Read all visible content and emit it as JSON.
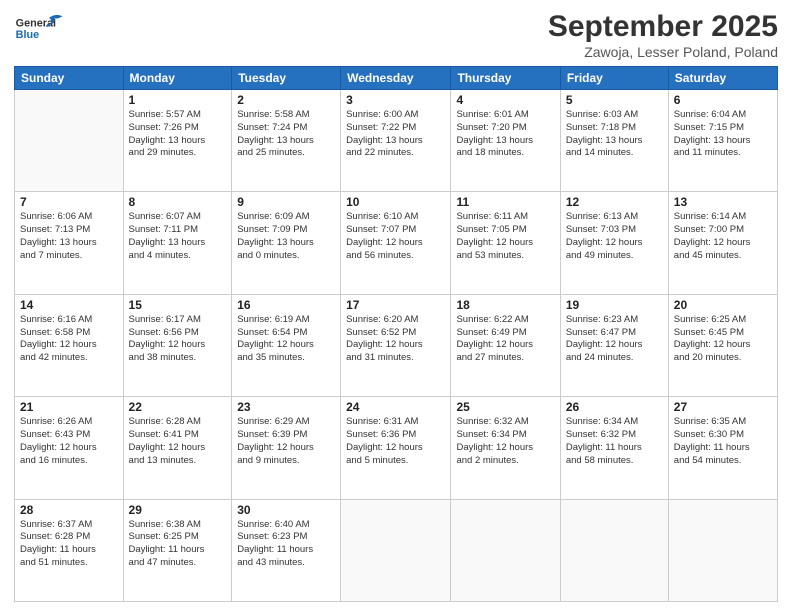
{
  "logo": {
    "line1": "General",
    "line2": "Blue"
  },
  "title": "September 2025",
  "subtitle": "Zawoja, Lesser Poland, Poland",
  "header_days": [
    "Sunday",
    "Monday",
    "Tuesday",
    "Wednesday",
    "Thursday",
    "Friday",
    "Saturday"
  ],
  "weeks": [
    [
      {
        "day": "",
        "detail": ""
      },
      {
        "day": "1",
        "detail": "Sunrise: 5:57 AM\nSunset: 7:26 PM\nDaylight: 13 hours\nand 29 minutes."
      },
      {
        "day": "2",
        "detail": "Sunrise: 5:58 AM\nSunset: 7:24 PM\nDaylight: 13 hours\nand 25 minutes."
      },
      {
        "day": "3",
        "detail": "Sunrise: 6:00 AM\nSunset: 7:22 PM\nDaylight: 13 hours\nand 22 minutes."
      },
      {
        "day": "4",
        "detail": "Sunrise: 6:01 AM\nSunset: 7:20 PM\nDaylight: 13 hours\nand 18 minutes."
      },
      {
        "day": "5",
        "detail": "Sunrise: 6:03 AM\nSunset: 7:18 PM\nDaylight: 13 hours\nand 14 minutes."
      },
      {
        "day": "6",
        "detail": "Sunrise: 6:04 AM\nSunset: 7:15 PM\nDaylight: 13 hours\nand 11 minutes."
      }
    ],
    [
      {
        "day": "7",
        "detail": "Sunrise: 6:06 AM\nSunset: 7:13 PM\nDaylight: 13 hours\nand 7 minutes."
      },
      {
        "day": "8",
        "detail": "Sunrise: 6:07 AM\nSunset: 7:11 PM\nDaylight: 13 hours\nand 4 minutes."
      },
      {
        "day": "9",
        "detail": "Sunrise: 6:09 AM\nSunset: 7:09 PM\nDaylight: 13 hours\nand 0 minutes."
      },
      {
        "day": "10",
        "detail": "Sunrise: 6:10 AM\nSunset: 7:07 PM\nDaylight: 12 hours\nand 56 minutes."
      },
      {
        "day": "11",
        "detail": "Sunrise: 6:11 AM\nSunset: 7:05 PM\nDaylight: 12 hours\nand 53 minutes."
      },
      {
        "day": "12",
        "detail": "Sunrise: 6:13 AM\nSunset: 7:03 PM\nDaylight: 12 hours\nand 49 minutes."
      },
      {
        "day": "13",
        "detail": "Sunrise: 6:14 AM\nSunset: 7:00 PM\nDaylight: 12 hours\nand 45 minutes."
      }
    ],
    [
      {
        "day": "14",
        "detail": "Sunrise: 6:16 AM\nSunset: 6:58 PM\nDaylight: 12 hours\nand 42 minutes."
      },
      {
        "day": "15",
        "detail": "Sunrise: 6:17 AM\nSunset: 6:56 PM\nDaylight: 12 hours\nand 38 minutes."
      },
      {
        "day": "16",
        "detail": "Sunrise: 6:19 AM\nSunset: 6:54 PM\nDaylight: 12 hours\nand 35 minutes."
      },
      {
        "day": "17",
        "detail": "Sunrise: 6:20 AM\nSunset: 6:52 PM\nDaylight: 12 hours\nand 31 minutes."
      },
      {
        "day": "18",
        "detail": "Sunrise: 6:22 AM\nSunset: 6:49 PM\nDaylight: 12 hours\nand 27 minutes."
      },
      {
        "day": "19",
        "detail": "Sunrise: 6:23 AM\nSunset: 6:47 PM\nDaylight: 12 hours\nand 24 minutes."
      },
      {
        "day": "20",
        "detail": "Sunrise: 6:25 AM\nSunset: 6:45 PM\nDaylight: 12 hours\nand 20 minutes."
      }
    ],
    [
      {
        "day": "21",
        "detail": "Sunrise: 6:26 AM\nSunset: 6:43 PM\nDaylight: 12 hours\nand 16 minutes."
      },
      {
        "day": "22",
        "detail": "Sunrise: 6:28 AM\nSunset: 6:41 PM\nDaylight: 12 hours\nand 13 minutes."
      },
      {
        "day": "23",
        "detail": "Sunrise: 6:29 AM\nSunset: 6:39 PM\nDaylight: 12 hours\nand 9 minutes."
      },
      {
        "day": "24",
        "detail": "Sunrise: 6:31 AM\nSunset: 6:36 PM\nDaylight: 12 hours\nand 5 minutes."
      },
      {
        "day": "25",
        "detail": "Sunrise: 6:32 AM\nSunset: 6:34 PM\nDaylight: 12 hours\nand 2 minutes."
      },
      {
        "day": "26",
        "detail": "Sunrise: 6:34 AM\nSunset: 6:32 PM\nDaylight: 11 hours\nand 58 minutes."
      },
      {
        "day": "27",
        "detail": "Sunrise: 6:35 AM\nSunset: 6:30 PM\nDaylight: 11 hours\nand 54 minutes."
      }
    ],
    [
      {
        "day": "28",
        "detail": "Sunrise: 6:37 AM\nSunset: 6:28 PM\nDaylight: 11 hours\nand 51 minutes."
      },
      {
        "day": "29",
        "detail": "Sunrise: 6:38 AM\nSunset: 6:25 PM\nDaylight: 11 hours\nand 47 minutes."
      },
      {
        "day": "30",
        "detail": "Sunrise: 6:40 AM\nSunset: 6:23 PM\nDaylight: 11 hours\nand 43 minutes."
      },
      {
        "day": "",
        "detail": ""
      },
      {
        "day": "",
        "detail": ""
      },
      {
        "day": "",
        "detail": ""
      },
      {
        "day": "",
        "detail": ""
      }
    ]
  ]
}
